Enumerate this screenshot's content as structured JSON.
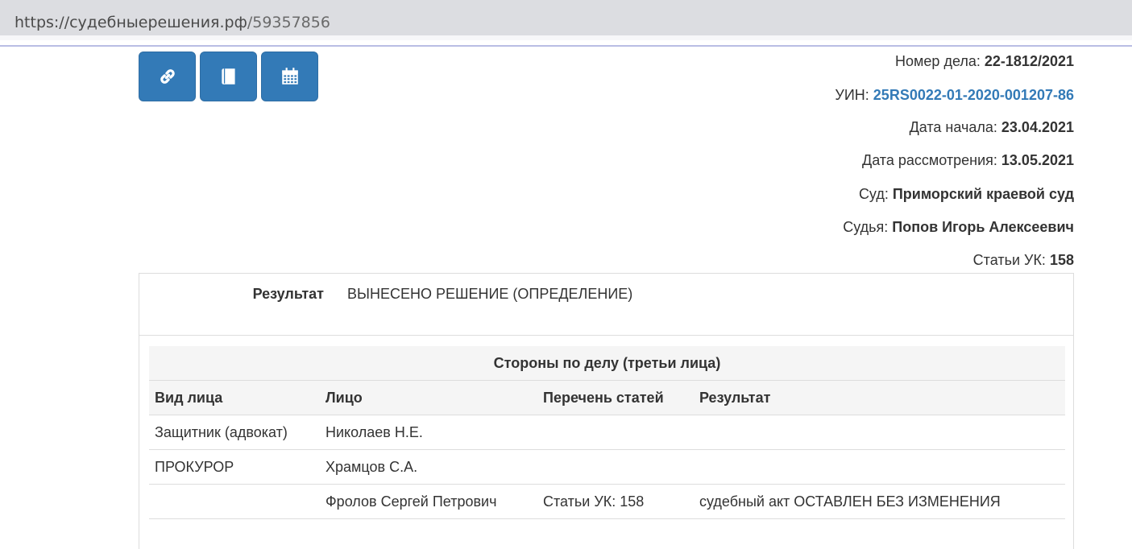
{
  "browser": {
    "url_host": "https://судебныерешения.рф",
    "url_path": "/59357856"
  },
  "toolbar": {
    "buttons": [
      {
        "icon": "link-icon"
      },
      {
        "icon": "book-icon"
      },
      {
        "icon": "calendar-icon"
      }
    ],
    "accent_color": "#337ab7"
  },
  "case_info": {
    "case_number_label": "Номер дела:",
    "case_number": "22-1812/2021",
    "uin_label": "УИН:",
    "uin": "25RS0022-01-2020-001207-86",
    "start_date_label": "Дата начала:",
    "start_date": "23.04.2021",
    "review_date_label": "Дата рассмотрения:",
    "review_date": "13.05.2021",
    "court_label": "Суд:",
    "court": "Приморский краевой суд",
    "judge_label": "Судья:",
    "judge": "Попов Игорь Алексеевич",
    "articles_label": "Статьи УК:",
    "articles": "158"
  },
  "result": {
    "label": "Результат",
    "value": "ВЫНЕСЕНО РЕШЕНИЕ (ОПРЕДЕЛЕНИЕ)"
  },
  "parties": {
    "caption": "Стороны по делу (третьи лица)",
    "columns": [
      "Вид лица",
      "Лицо",
      "Перечень статей",
      "Результат"
    ],
    "rows": [
      [
        "Защитник (адвокат)",
        "Николаев Н.Е.",
        "",
        ""
      ],
      [
        "ПРОКУРОР",
        "Храмцов С.А.",
        "",
        ""
      ],
      [
        "",
        "Фролов Сергей Петрович",
        "Статьи УК: 158",
        "судебный акт ОСТАВЛЕН БЕЗ ИЗМЕНЕНИЯ"
      ]
    ]
  }
}
